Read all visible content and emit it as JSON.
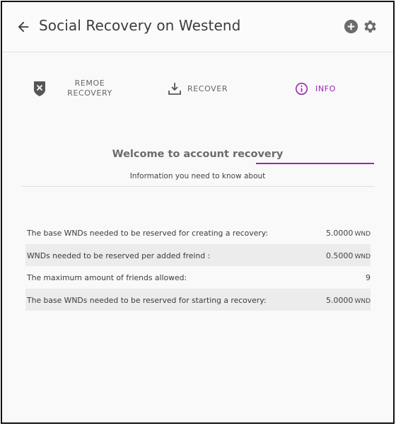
{
  "header": {
    "title": "Social Recovery on Westend"
  },
  "tabs": [
    {
      "label": "REMOE RECOVERY",
      "icon": "remove-shield-icon",
      "active": false
    },
    {
      "label": "RECOVER",
      "icon": "download-icon",
      "active": false
    },
    {
      "label": "INFO",
      "icon": "info-icon",
      "active": true
    }
  ],
  "info": {
    "title": "Welcome to account recovery",
    "subtitle": "Information you need to know about",
    "rows": [
      {
        "label": "The base WNDs needed to be reserved for creating a recovery:",
        "value": "5.0000",
        "unit": "WND"
      },
      {
        "label": "WNDs needed to be reserved per added freind :",
        "value": "0.5000",
        "unit": "WND"
      },
      {
        "label": "The maximum amount of friends allowed:",
        "value": "9",
        "unit": ""
      },
      {
        "label": "The base WNDs needed to be reserved for starting a recovery:",
        "value": "5.0000",
        "unit": "WND"
      }
    ]
  },
  "colors": {
    "accent": "#9c27b0",
    "icon_gray": "#6b6b6b"
  }
}
